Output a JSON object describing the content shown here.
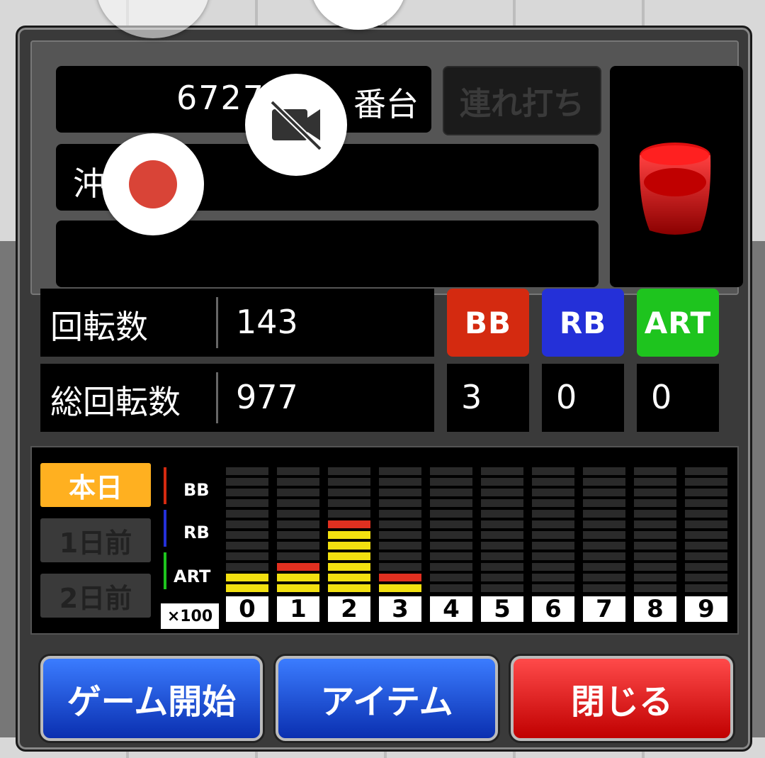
{
  "machine": {
    "number": "6727",
    "suffix": "番台",
    "renda_label": "連れ打ち",
    "name": "沖",
    "sub_text": ""
  },
  "stats": {
    "spins_label": "回転数",
    "spins_value": "143",
    "total_label": "総回転数",
    "total_value": "977",
    "badges": [
      {
        "label": "BB",
        "color": "#d42a10",
        "count": "3"
      },
      {
        "label": "RB",
        "color": "#2430d8",
        "count": "0"
      },
      {
        "label": "ART",
        "color": "#1ec41e",
        "count": "0"
      }
    ]
  },
  "graph": {
    "days": [
      {
        "label": "本日",
        "active": true
      },
      {
        "label": "1日前",
        "active": false
      },
      {
        "label": "2日前",
        "active": false
      }
    ],
    "legend": [
      "BB",
      "RB",
      "ART"
    ],
    "scale_label": "×100",
    "columns": [
      "0",
      "1",
      "2",
      "3",
      "4",
      "5",
      "6",
      "7",
      "8",
      "9"
    ],
    "chart_data": {
      "type": "bar",
      "categories": [
        "0",
        "1",
        "2",
        "3",
        "4",
        "5",
        "6",
        "7",
        "8",
        "9"
      ],
      "series": [
        {
          "name": "BB",
          "values": [
            0,
            0,
            0,
            0,
            0,
            0,
            0,
            0,
            0,
            0
          ]
        },
        {
          "name": "RB",
          "values": [
            0,
            1,
            1,
            1,
            0,
            0,
            0,
            0,
            0,
            0
          ]
        },
        {
          "name": "ART",
          "values": [
            0,
            0,
            0,
            0,
            0,
            0,
            0,
            0,
            0,
            0
          ]
        }
      ],
      "segments_filled": [
        2,
        3,
        7,
        2,
        0,
        0,
        0,
        0,
        0,
        0
      ],
      "top_color": [
        "yellow",
        "red",
        "red",
        "red",
        "none",
        "none",
        "none",
        "none",
        "none",
        "none"
      ]
    }
  },
  "buttons": {
    "start": "ゲーム開始",
    "item": "アイテム",
    "close": "閉じる"
  }
}
